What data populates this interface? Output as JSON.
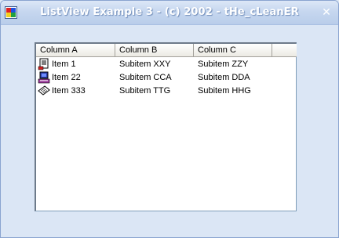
{
  "window": {
    "title": "ListView Example 3 - (c) 2002 - tHe_cLeanER",
    "close_symbol": "✕"
  },
  "listview": {
    "columns": [
      "Column A",
      "Column B",
      "Column C",
      ""
    ],
    "rows": [
      {
        "icon": "document-icon",
        "cells": [
          "Item 1",
          "Subitem XXY",
          "Subitem ZZY"
        ]
      },
      {
        "icon": "computer-icon",
        "cells": [
          "Item 22",
          "Subitem CCA",
          "Subitem DDA"
        ]
      },
      {
        "icon": "paper-icon",
        "cells": [
          "Item 333",
          "Subitem TTG",
          "Subitem HHG"
        ]
      }
    ]
  }
}
